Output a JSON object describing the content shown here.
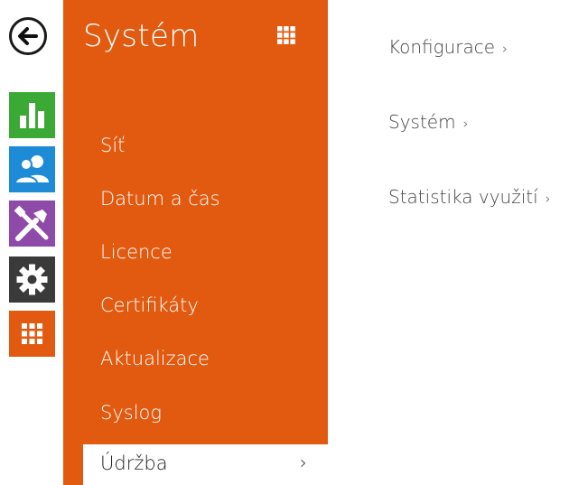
{
  "sidebar": {
    "back_label": "",
    "tiles": [
      {
        "icon": "status-chart-icon",
        "color": "#3aaa35"
      },
      {
        "icon": "users-icon",
        "color": "#1e8bd6"
      },
      {
        "icon": "tools-icon",
        "color": "#8e4aa8"
      },
      {
        "icon": "gear-icon",
        "color": "#3a3a3a"
      },
      {
        "icon": "grid-icon",
        "color": "#e15a10"
      }
    ]
  },
  "panel": {
    "title": "Systém",
    "accent": "#e15a10",
    "items": [
      {
        "label": "Síť"
      },
      {
        "label": "Datum a čas"
      },
      {
        "label": "Licence"
      },
      {
        "label": "Certifikáty"
      },
      {
        "label": "Aktualizace"
      },
      {
        "label": "Syslog"
      },
      {
        "label": "Údržba",
        "active": true,
        "chevron": "›"
      }
    ]
  },
  "content": {
    "links": [
      {
        "label": "Konfigurace",
        "chevron": "›"
      },
      {
        "label": "Systém",
        "chevron": "›"
      },
      {
        "label": "Statistika využití",
        "chevron": "›"
      }
    ]
  }
}
